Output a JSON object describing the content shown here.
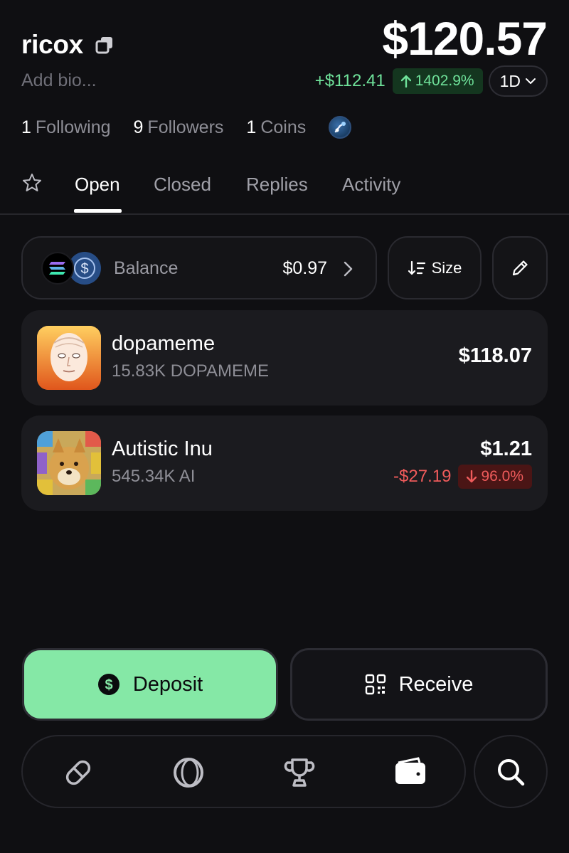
{
  "profile": {
    "username": "ricox",
    "bio_placeholder": "Add bio...",
    "total_value": "$120.57",
    "change_amount": "+$112.41",
    "change_percent": "1402.9%",
    "period": "1D"
  },
  "stats": {
    "following_count": "1",
    "following_label": "Following",
    "followers_count": "9",
    "followers_label": "Followers",
    "coins_count": "1",
    "coins_label": "Coins"
  },
  "tabs": [
    {
      "label": "Open",
      "active": true
    },
    {
      "label": "Closed",
      "active": false
    },
    {
      "label": "Replies",
      "active": false
    },
    {
      "label": "Activity",
      "active": false
    }
  ],
  "balance": {
    "label": "Balance",
    "value": "$0.97"
  },
  "sort": {
    "label": "Size"
  },
  "holdings": [
    {
      "name": "dopameme",
      "amount": "15.83K DOPAMEME",
      "value": "$118.07"
    },
    {
      "name": "Autistic Inu",
      "amount": "545.34K AI",
      "value": "$1.21",
      "change_amount": "-$27.19",
      "change_percent": "96.0%"
    }
  ],
  "actions": {
    "deposit_label": "Deposit",
    "receive_label": "Receive"
  },
  "nav": {
    "items": [
      "pill-icon",
      "orb-icon",
      "trophy-icon",
      "wallet-icon"
    ],
    "search": "search-icon"
  },
  "colors": {
    "background": "#0f0f12",
    "positive": "#6fe29a",
    "negative": "#ef5b5b",
    "accent": "#85e8a6"
  }
}
